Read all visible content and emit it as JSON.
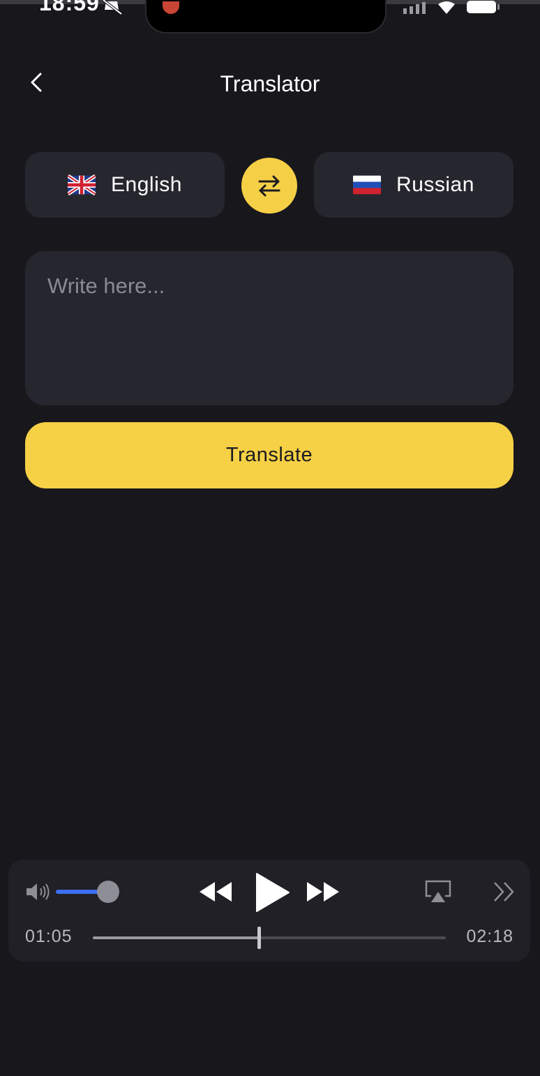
{
  "status_bar": {
    "time": "18:59"
  },
  "header": {
    "title": "Translator",
    "back_icon": "chevron-left-icon"
  },
  "languages": {
    "source": {
      "label": "English",
      "flag": "uk-flag-icon"
    },
    "target": {
      "label": "Russian",
      "flag": "russia-flag-icon"
    },
    "swap_icon": "swap-arrows-icon"
  },
  "input": {
    "placeholder": "Write here...",
    "value": ""
  },
  "translate_button": {
    "label": "Translate"
  },
  "player": {
    "current_time": "01:05",
    "total_time": "02:18",
    "progress": 0.47,
    "volume": 1.0
  },
  "colors": {
    "background": "#18171c",
    "card": "#26262e",
    "accent": "#f6d146",
    "volume_fill": "#3c6ef0"
  }
}
